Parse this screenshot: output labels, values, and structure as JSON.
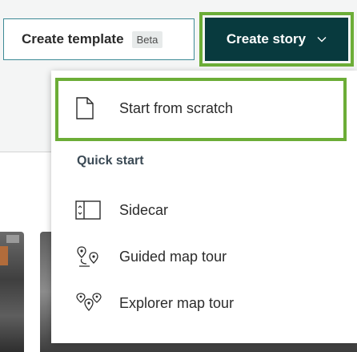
{
  "header": {
    "create_template_label": "Create template",
    "create_template_badge": "Beta",
    "create_story_label": "Create story"
  },
  "menu": {
    "start_from_scratch": "Start from scratch",
    "quick_start_heading": "Quick start",
    "items": [
      {
        "label": "Sidecar",
        "icon": "sidecar-icon"
      },
      {
        "label": "Guided map tour",
        "icon": "guided-map-tour-icon"
      },
      {
        "label": "Explorer map tour",
        "icon": "explorer-map-tour-icon"
      }
    ]
  },
  "colors": {
    "primary_button": "#083a3e",
    "focus_outline": "#6cad37",
    "secondary_border": "#3c8a95"
  }
}
